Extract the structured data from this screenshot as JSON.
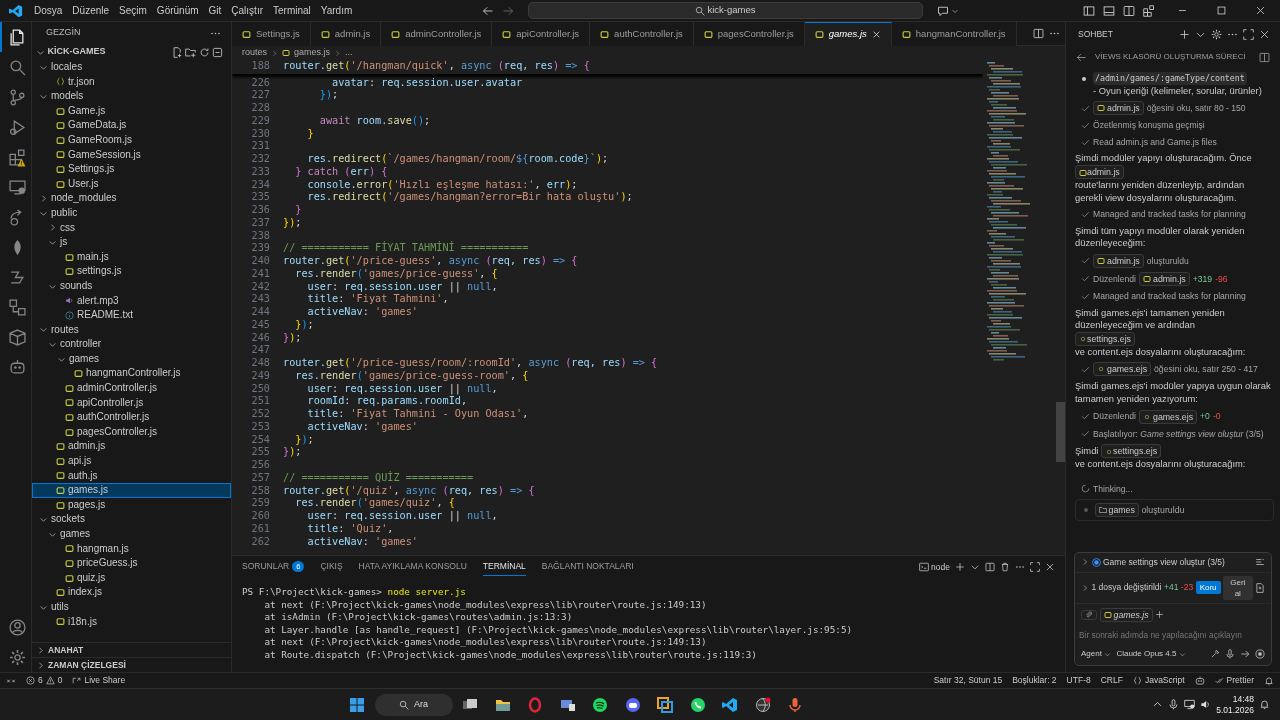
{
  "menu": [
    "Dosya",
    "Düzenle",
    "Seçim",
    "Görünüm",
    "Git",
    "Çalıştır",
    "Terminal",
    "Yardım"
  ],
  "title_search": "kick-games",
  "activity_bar": [
    {
      "selected": true
    },
    {
      "selected": false
    },
    {
      "selected": false
    },
    {
      "selected": false
    },
    {
      "selected": false
    },
    {
      "selected": false
    },
    {
      "selected": false
    },
    {
      "selected": false
    },
    {
      "selected": false
    },
    {
      "selected": false
    },
    {
      "selected": false
    },
    {
      "selected": false
    }
  ],
  "explorer": {
    "title": "GEZGİN",
    "project": "KİCK-GAMES",
    "tree": [
      {
        "name": "locales",
        "kind": "folder",
        "expanded": true,
        "selected": false,
        "children": [
          {
            "name": "tr.json",
            "kind": "json",
            "selected": false
          }
        ]
      },
      {
        "name": "models",
        "kind": "folder",
        "expanded": true,
        "selected": false,
        "children": [
          {
            "name": "Game.js",
            "kind": "js",
            "selected": false
          },
          {
            "name": "GameData.js",
            "kind": "js",
            "selected": false
          },
          {
            "name": "GameRoom.js",
            "kind": "js",
            "selected": false
          },
          {
            "name": "GameSession.js",
            "kind": "js",
            "selected": false
          },
          {
            "name": "Settings.js",
            "kind": "js",
            "selected": false
          },
          {
            "name": "User.js",
            "kind": "js",
            "selected": false
          }
        ]
      },
      {
        "name": "node_modules",
        "kind": "folder",
        "expanded": false,
        "selected": false
      },
      {
        "name": "public",
        "kind": "folder",
        "expanded": true,
        "selected": false,
        "children": [
          {
            "name": "css",
            "kind": "folder",
            "expanded": false,
            "selected": false
          },
          {
            "name": "js",
            "kind": "folder",
            "expanded": true,
            "selected": false,
            "children": [
              {
                "name": "main.js",
                "kind": "js",
                "selected": false
              },
              {
                "name": "settings.js",
                "kind": "js",
                "selected": false
              }
            ]
          },
          {
            "name": "sounds",
            "kind": "folder",
            "expanded": true,
            "selected": false,
            "children": [
              {
                "name": "alert.mp3",
                "kind": "audio",
                "selected": false
              },
              {
                "name": "README.txt",
                "kind": "info",
                "selected": false
              }
            ]
          }
        ]
      },
      {
        "name": "routes",
        "kind": "folder",
        "expanded": true,
        "selected": false,
        "children": [
          {
            "name": "controller",
            "kind": "folder",
            "expanded": true,
            "selected": false,
            "children": [
              {
                "name": "games",
                "kind": "folder",
                "expanded": true,
                "selected": false,
                "children": [
                  {
                    "name": "hangmanController.js",
                    "kind": "js",
                    "selected": false
                  }
                ]
              },
              {
                "name": "adminController.js",
                "kind": "js",
                "selected": false
              },
              {
                "name": "apiController.js",
                "kind": "js",
                "selected": false
              },
              {
                "name": "authController.js",
                "kind": "js",
                "selected": false
              },
              {
                "name": "pagesController.js",
                "kind": "js",
                "selected": false
              }
            ]
          },
          {
            "name": "admin.js",
            "kind": "js",
            "selected": false
          },
          {
            "name": "api.js",
            "kind": "js",
            "selected": false
          },
          {
            "name": "auth.js",
            "kind": "js",
            "selected": false
          },
          {
            "name": "games.js",
            "kind": "js",
            "selected": true
          },
          {
            "name": "pages.js",
            "kind": "js",
            "selected": false
          }
        ]
      },
      {
        "name": "sockets",
        "kind": "folder",
        "expanded": true,
        "selected": false,
        "children": [
          {
            "name": "games",
            "kind": "folder",
            "expanded": true,
            "selected": false,
            "children": [
              {
                "name": "hangman.js",
                "kind": "js",
                "selected": false
              },
              {
                "name": "priceGuess.js",
                "kind": "js",
                "selected": false
              },
              {
                "name": "quiz.js",
                "kind": "js",
                "selected": false
              }
            ]
          },
          {
            "name": "index.js",
            "kind": "js",
            "selected": false
          }
        ]
      },
      {
        "name": "utils",
        "kind": "folder",
        "expanded": true,
        "selected": false,
        "children": [
          {
            "name": "i18n.js",
            "kind": "js",
            "selected": false
          }
        ]
      }
    ],
    "sections": [
      {
        "label": "ANAHAT",
        "expanded": false
      },
      {
        "label": "ZAMAN ÇİZELGESİ",
        "expanded": false
      }
    ]
  },
  "tabs": [
    {
      "label": "Settings.js",
      "selected": false
    },
    {
      "label": "admin.js",
      "selected": false
    },
    {
      "label": "adminController.js",
      "selected": false
    },
    {
      "label": "apiController.js",
      "selected": false
    },
    {
      "label": "authController.js",
      "selected": false
    },
    {
      "label": "pagesController.js",
      "selected": false
    },
    {
      "label": "games.js",
      "selected": true
    },
    {
      "label": "hangmanController.js",
      "selected": false
    }
  ],
  "breadcrumb": [
    "routes",
    "games.js",
    "..."
  ],
  "sticky_line": {
    "n": "188",
    "tokens": [
      {
        "text": "router.",
        "kind": "variable"
      },
      {
        "text": "get",
        "kind": "function"
      },
      {
        "text": "(",
        "kind": "bracket1"
      },
      {
        "text": "'/hangman/quick'",
        "kind": "string"
      },
      {
        "text": ", ",
        "kind": "plain"
      },
      {
        "text": "async",
        "kind": "keyword"
      },
      {
        "text": " (",
        "kind": "bracket2"
      },
      {
        "text": "req, res",
        "kind": "variable"
      },
      {
        "text": ")",
        "kind": "bracket2"
      },
      {
        "text": " => ",
        "kind": "keyword"
      },
      {
        "text": "{",
        "kind": "bracket2"
      }
    ]
  },
  "code": [
    {
      "n": "226",
      "tokens": [
        {
          "text": "        avatar",
          "kind": "variable"
        },
        {
          "text": ": ",
          "kind": "plain"
        },
        {
          "text": "req.session.user.avatar",
          "kind": "variable"
        }
      ]
    },
    {
      "n": "227",
      "tokens": [
        {
          "text": "      })",
          "kind": "bracket3"
        },
        {
          "text": ";",
          "kind": "plain"
        }
      ]
    },
    {
      "n": "228"
    },
    {
      "n": "229",
      "tokens": [
        {
          "text": "      await",
          "kind": "control"
        },
        {
          "text": " room.",
          "kind": "variable"
        },
        {
          "text": "save",
          "kind": "function"
        },
        {
          "text": "()",
          "kind": "bracket3"
        },
        {
          "text": ";",
          "kind": "plain"
        }
      ]
    },
    {
      "n": "230",
      "tokens": [
        {
          "text": "    }",
          "kind": "bracket1"
        }
      ]
    },
    {
      "n": "231"
    },
    {
      "n": "232",
      "tokens": [
        {
          "text": "    res.",
          "kind": "variable"
        },
        {
          "text": "redirect",
          "kind": "function"
        },
        {
          "text": "(",
          "kind": "bracket1"
        },
        {
          "text": "`/games/hangman/room/",
          "kind": "string"
        },
        {
          "text": "${",
          "kind": "keyword"
        },
        {
          "text": "room.code",
          "kind": "variable"
        },
        {
          "text": "}",
          "kind": "keyword"
        },
        {
          "text": "`",
          "kind": "string"
        },
        {
          "text": ")",
          "kind": "bracket1"
        },
        {
          "text": ";",
          "kind": "plain"
        }
      ]
    },
    {
      "n": "233",
      "tokens": [
        {
          "text": "  }",
          "kind": "bracket2"
        },
        {
          "text": " catch ",
          "kind": "control"
        },
        {
          "text": "(",
          "kind": "bracket2"
        },
        {
          "text": "err",
          "kind": "variable"
        },
        {
          "text": ") {",
          "kind": "bracket2"
        }
      ]
    },
    {
      "n": "234",
      "tokens": [
        {
          "text": "    console.",
          "kind": "variable"
        },
        {
          "text": "error",
          "kind": "function"
        },
        {
          "text": "(",
          "kind": "bracket1"
        },
        {
          "text": "'Hızlı eşleşme hatası:'",
          "kind": "string"
        },
        {
          "text": ", ",
          "kind": "plain"
        },
        {
          "text": "err",
          "kind": "variable"
        },
        {
          "text": ")",
          "kind": "bracket1"
        },
        {
          "text": ";",
          "kind": "plain"
        }
      ]
    },
    {
      "n": "235",
      "tokens": [
        {
          "text": "    res.",
          "kind": "variable"
        },
        {
          "text": "redirect",
          "kind": "function"
        },
        {
          "text": "(",
          "kind": "bracket1"
        },
        {
          "text": "'/games/hangman?error=Bir hata oluştu'",
          "kind": "string"
        },
        {
          "text": ")",
          "kind": "bracket1"
        },
        {
          "text": ";",
          "kind": "plain"
        }
      ]
    },
    {
      "n": "236",
      "tokens": [
        {
          "text": "  }",
          "kind": "bracket2"
        }
      ]
    },
    {
      "n": "237",
      "tokens": [
        {
          "text": "})",
          "kind": "bracket1"
        },
        {
          "text": ";",
          "kind": "plain"
        }
      ]
    },
    {
      "n": "238"
    },
    {
      "n": "239",
      "tokens": [
        {
          "text": "// =========== FİYAT TAHMİNİ ===========",
          "kind": "comment"
        }
      ]
    },
    {
      "n": "240",
      "tokens": [
        {
          "text": "router.",
          "kind": "variable"
        },
        {
          "text": "get",
          "kind": "function"
        },
        {
          "text": "(",
          "kind": "bracket1"
        },
        {
          "text": "'/price-guess'",
          "kind": "string"
        },
        {
          "text": ", ",
          "kind": "plain"
        },
        {
          "text": "async",
          "kind": "keyword"
        },
        {
          "text": " (",
          "kind": "bracket2"
        },
        {
          "text": "req, res",
          "kind": "variable"
        },
        {
          "text": ")",
          "kind": "bracket2"
        },
        {
          "text": " => ",
          "kind": "keyword"
        },
        {
          "text": "{",
          "kind": "bracket2"
        }
      ]
    },
    {
      "n": "241",
      "tokens": [
        {
          "text": "  res.",
          "kind": "variable"
        },
        {
          "text": "render",
          "kind": "function"
        },
        {
          "text": "(",
          "kind": "bracket3"
        },
        {
          "text": "'games/price-guess'",
          "kind": "string"
        },
        {
          "text": ", ",
          "kind": "plain"
        },
        {
          "text": "{",
          "kind": "bracket1"
        }
      ]
    },
    {
      "n": "242",
      "tokens": [
        {
          "text": "    user",
          "kind": "variable"
        },
        {
          "text": ": ",
          "kind": "plain"
        },
        {
          "text": "req.session.user",
          "kind": "variable"
        },
        {
          "text": " || ",
          "kind": "plain"
        },
        {
          "text": "null",
          "kind": "keyword"
        },
        {
          "text": ",",
          "kind": "plain"
        }
      ]
    },
    {
      "n": "243",
      "tokens": [
        {
          "text": "    title",
          "kind": "variable"
        },
        {
          "text": ": ",
          "kind": "plain"
        },
        {
          "text": "'Fiyat Tahmini'",
          "kind": "string"
        },
        {
          "text": ",",
          "kind": "plain"
        }
      ]
    },
    {
      "n": "244",
      "tokens": [
        {
          "text": "    activeNav",
          "kind": "variable"
        },
        {
          "text": ": ",
          "kind": "plain"
        },
        {
          "text": "'games'",
          "kind": "string"
        }
      ]
    },
    {
      "n": "245",
      "tokens": [
        {
          "text": "  }",
          "kind": "bracket1"
        },
        {
          "text": ")",
          "kind": "bracket3"
        },
        {
          "text": ";",
          "kind": "plain"
        }
      ]
    },
    {
      "n": "246",
      "tokens": [
        {
          "text": "}",
          "kind": "bracket2"
        },
        {
          "text": ")",
          "kind": "bracket1"
        },
        {
          "text": ";",
          "kind": "plain"
        }
      ]
    },
    {
      "n": "247"
    },
    {
      "n": "248",
      "tokens": [
        {
          "text": "router.",
          "kind": "variable"
        },
        {
          "text": "get",
          "kind": "function"
        },
        {
          "text": "(",
          "kind": "bracket1"
        },
        {
          "text": "'/price-guess/room/:roomId'",
          "kind": "string"
        },
        {
          "text": ", ",
          "kind": "plain"
        },
        {
          "text": "async",
          "kind": "keyword"
        },
        {
          "text": " (",
          "kind": "bracket2"
        },
        {
          "text": "req, res",
          "kind": "variable"
        },
        {
          "text": ")",
          "kind": "bracket2"
        },
        {
          "text": " => ",
          "kind": "keyword"
        },
        {
          "text": "{",
          "kind": "bracket2"
        }
      ]
    },
    {
      "n": "249",
      "tokens": [
        {
          "text": "  res.",
          "kind": "variable"
        },
        {
          "text": "render",
          "kind": "function"
        },
        {
          "text": "(",
          "kind": "bracket3"
        },
        {
          "text": "'games/price-guess-room'",
          "kind": "string"
        },
        {
          "text": ", ",
          "kind": "plain"
        },
        {
          "text": "{",
          "kind": "bracket1"
        }
      ]
    },
    {
      "n": "250",
      "tokens": [
        {
          "text": "    user",
          "kind": "variable"
        },
        {
          "text": ": ",
          "kind": "plain"
        },
        {
          "text": "req.session.user",
          "kind": "variable"
        },
        {
          "text": " || ",
          "kind": "plain"
        },
        {
          "text": "null",
          "kind": "keyword"
        },
        {
          "text": ",",
          "kind": "plain"
        }
      ]
    },
    {
      "n": "251",
      "tokens": [
        {
          "text": "    roomId",
          "kind": "variable"
        },
        {
          "text": ": ",
          "kind": "plain"
        },
        {
          "text": "req.params.roomId",
          "kind": "variable"
        },
        {
          "text": ",",
          "kind": "plain"
        }
      ]
    },
    {
      "n": "252",
      "tokens": [
        {
          "text": "    title",
          "kind": "variable"
        },
        {
          "text": ": ",
          "kind": "plain"
        },
        {
          "text": "'Fiyat Tahmini - Oyun Odası'",
          "kind": "string"
        },
        {
          "text": ",",
          "kind": "plain"
        }
      ]
    },
    {
      "n": "253",
      "tokens": [
        {
          "text": "    activeNav",
          "kind": "variable"
        },
        {
          "text": ": ",
          "kind": "plain"
        },
        {
          "text": "'games'",
          "kind": "string"
        }
      ]
    },
    {
      "n": "254",
      "tokens": [
        {
          "text": "  }",
          "kind": "bracket1"
        },
        {
          "text": ")",
          "kind": "bracket3"
        },
        {
          "text": ";",
          "kind": "plain"
        }
      ]
    },
    {
      "n": "255",
      "tokens": [
        {
          "text": "}",
          "kind": "bracket2"
        },
        {
          "text": ")",
          "kind": "bracket1"
        },
        {
          "text": ";",
          "kind": "plain"
        }
      ]
    },
    {
      "n": "256"
    },
    {
      "n": "257",
      "tokens": [
        {
          "text": "// =========== QUİZ ===========",
          "kind": "comment"
        }
      ]
    },
    {
      "n": "258",
      "tokens": [
        {
          "text": "router.",
          "kind": "variable"
        },
        {
          "text": "get",
          "kind": "function"
        },
        {
          "text": "(",
          "kind": "bracket1"
        },
        {
          "text": "'/quiz'",
          "kind": "string"
        },
        {
          "text": ", ",
          "kind": "plain"
        },
        {
          "text": "async",
          "kind": "keyword"
        },
        {
          "text": " (",
          "kind": "bracket2"
        },
        {
          "text": "req, res",
          "kind": "variable"
        },
        {
          "text": ")",
          "kind": "bracket2"
        },
        {
          "text": " => ",
          "kind": "keyword"
        },
        {
          "text": "{",
          "kind": "bracket2"
        }
      ]
    },
    {
      "n": "259",
      "tokens": [
        {
          "text": "  res.",
          "kind": "variable"
        },
        {
          "text": "render",
          "kind": "function"
        },
        {
          "text": "(",
          "kind": "bracket3"
        },
        {
          "text": "'games/quiz'",
          "kind": "string"
        },
        {
          "text": ", ",
          "kind": "plain"
        },
        {
          "text": "{",
          "kind": "bracket1"
        }
      ]
    },
    {
      "n": "260",
      "tokens": [
        {
          "text": "    user",
          "kind": "variable"
        },
        {
          "text": ": ",
          "kind": "plain"
        },
        {
          "text": "req.session.user",
          "kind": "variable"
        },
        {
          "text": " || ",
          "kind": "plain"
        },
        {
          "text": "null",
          "kind": "keyword"
        },
        {
          "text": ",",
          "kind": "plain"
        }
      ]
    },
    {
      "n": "261",
      "tokens": [
        {
          "text": "    title",
          "kind": "variable"
        },
        {
          "text": ": ",
          "kind": "plain"
        },
        {
          "text": "'Quiz'",
          "kind": "string"
        },
        {
          "text": ",",
          "kind": "plain"
        }
      ]
    },
    {
      "n": "262",
      "tokens": [
        {
          "text": "    activeNav",
          "kind": "variable"
        },
        {
          "text": ": ",
          "kind": "plain"
        },
        {
          "text": "'games'",
          "kind": "string"
        }
      ]
    }
  ],
  "panel": {
    "tabs": [
      {
        "label": "SORUNLAR",
        "badge": "6",
        "selected": false
      },
      {
        "label": "ÇIKIŞ",
        "selected": false
      },
      {
        "label": "HATA AYIKLAMA KONSOLU",
        "selected": false
      },
      {
        "label": "TERMİNAL",
        "selected": true
      },
      {
        "label": "BAĞLANTI NOKTALARI",
        "selected": false
      }
    ],
    "shell": "node",
    "prompt": "PS F:\\Project\\kick-games> ",
    "command": "node server.js",
    "output": [
      "    at next (F:\\Project\\kick-games\\node_modules\\express\\lib\\router\\route.js:149:13)",
      "    at isAdmin (F:\\Project\\kick-games\\routes\\admin.js:13:3)",
      "    at Layer.handle [as handle_request] (F:\\Project\\kick-games\\node_modules\\express\\lib\\router\\layer.js:95:5)",
      "    at next (F:\\Project\\kick-games\\node_modules\\express\\lib\\router\\route.js:149:13)",
      "    at Route.dispatch (F:\\Project\\kick-games\\node_modules\\express\\lib\\router\\route.js:119:3)"
    ]
  },
  "chat": {
    "title": "SOHBET",
    "session": "VİEWS KLASÖRÜ OLUŞTURMA SÜRECİ",
    "entries": [
      {
        "kind": "bullet",
        "parts": [
          {
            "kind": "code",
            "text": "/admin/games/:gameType/content"
          },
          {
            "kind": "text",
            "text": "- Oyun içeriği (kelimeler, sorular, ürünler)"
          }
        ]
      },
      {
        "kind": "step",
        "parts": [
          {
            "kind": "jsfile",
            "text": "admin.js"
          },
          {
            "kind": "text",
            "text": "öğesini oku, satır 80 - 150"
          }
        ]
      },
      {
        "kind": "step",
        "parts": [
          {
            "kind": "text",
            "text": "Özetlenmiş konuşma geçmişi"
          }
        ]
      },
      {
        "kind": "step",
        "parts": [
          {
            "kind": "text",
            "text": "Read admin.js and Game.js files"
          }
        ]
      },
      {
        "kind": "para",
        "parts": [
          {
            "kind": "text",
            "text": "Şimdi modüler yapıyı oluşturacağım. Önce"
          },
          {
            "kind": "jsfile",
            "text": "admin.js"
          },
          {
            "kind": "text",
            "text": "route'larını yeniden düzenleyip, ardından gerekli view dosyalarını oluşturacağım."
          }
        ]
      },
      {
        "kind": "step",
        "parts": [
          {
            "kind": "text",
            "text": "Managed and tracked tasks for planning"
          }
        ]
      },
      {
        "kind": "para",
        "parts": [
          {
            "kind": "text",
            "text": "Şimdi tüm yapıyı modüler olarak yeniden düzenleyeceğim:"
          }
        ]
      },
      {
        "kind": "step",
        "parts": [
          {
            "kind": "jsfile",
            "text": "admin.js"
          },
          {
            "kind": "text",
            "text": "oluşturuldu"
          }
        ]
      },
      {
        "kind": "step",
        "parts": [
          {
            "kind": "text",
            "text": "Düzenlendi"
          },
          {
            "kind": "jsfile",
            "text": "admin.js"
          },
          {
            "kind": "added",
            "text": "+319"
          },
          {
            "kind": "removed",
            "text": "-96"
          }
        ]
      },
      {
        "kind": "step",
        "parts": [
          {
            "kind": "text",
            "text": "Managed and tracked tasks for planning"
          }
        ]
      },
      {
        "kind": "para",
        "parts": [
          {
            "kind": "text",
            "text": "Şimdi games.ejs'i tamamen yeniden düzenleyeceğim ve ardından"
          },
          {
            "kind": "ejsfile",
            "text": "settings.ejs"
          },
          {
            "kind": "text",
            "text": "ve content.ejs dosyalarını oluşturacağım:"
          }
        ]
      },
      {
        "kind": "step",
        "parts": [
          {
            "kind": "ejsfile",
            "text": "games.ejs"
          },
          {
            "kind": "text",
            "text": "öğesini oku, satır 250 - 417"
          }
        ]
      },
      {
        "kind": "para",
        "parts": [
          {
            "kind": "text",
            "text": "Şimdi games.ejs'i modüler yapıya uygun olarak tamamen yeniden yazıyorum:"
          }
        ]
      },
      {
        "kind": "step",
        "parts": [
          {
            "kind": "text",
            "text": "Düzenlendi"
          },
          {
            "kind": "ejsfile",
            "text": "games.ejs"
          },
          {
            "kind": "added",
            "text": "+0"
          },
          {
            "kind": "removed",
            "text": "-0"
          }
        ]
      },
      {
        "kind": "step",
        "parts": [
          {
            "kind": "text",
            "text": "Başlatılıyor: *Game settings view oluştur* (3/5)"
          }
        ]
      },
      {
        "kind": "para",
        "parts": [
          {
            "kind": "text",
            "text": "Şimdi"
          },
          {
            "kind": "ejsfile",
            "text": "settings.ejs"
          },
          {
            "kind": "text",
            "text": "ve content.ejs dosyalarını oluşturacağım:"
          }
        ]
      },
      {
        "kind": "thinking",
        "parts": [
          {
            "kind": "text",
            "text": "Thinking..."
          }
        ]
      },
      {
        "kind": "created",
        "parts": [
          {
            "kind": "folder",
            "text": "games"
          },
          {
            "kind": "text",
            "text": "oluşturuldu"
          }
        ]
      }
    ],
    "task": "Game settings view oluştur (3/5)",
    "changes": {
      "label": "1 dosya değiştirildi",
      "added": "+41",
      "removed": "-23",
      "keep": "Koru",
      "undo": "Geri al"
    },
    "attachment": "games.js",
    "placeholder": "Bir sonraki adımda ne yapılacağını açıklayın",
    "mode": "Agent",
    "model": "Claude Opus 4.5"
  },
  "status_bar": {
    "errors": "6",
    "warnings": "0",
    "live_share": "Live Share",
    "position": "Satır 32, Sütun 15",
    "spaces": "Boşluklar: 2",
    "encoding": "UTF-8",
    "eol": "CRLF",
    "language": "JavaScript",
    "formatter": "Prettier"
  },
  "taskbar": {
    "search": "Ara",
    "time": "14:48",
    "date": "5.01.2026"
  }
}
